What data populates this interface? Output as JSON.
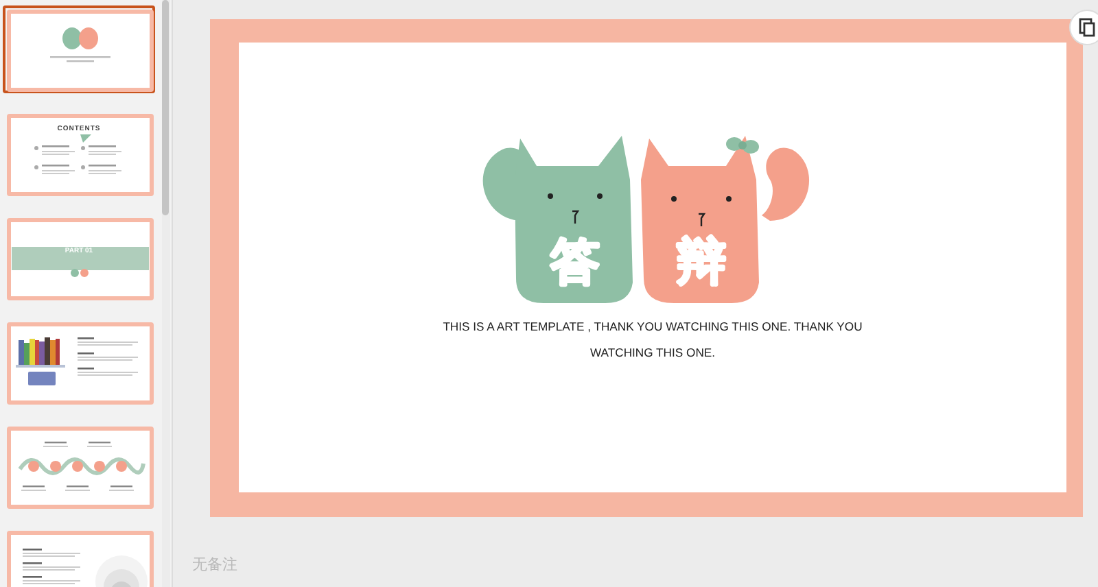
{
  "thumbnails": [
    {
      "kind": "title",
      "selected": true
    },
    {
      "kind": "contents",
      "heading": "CONTENTS",
      "selected": false
    },
    {
      "kind": "section",
      "heading": "PART 01",
      "selected": false
    },
    {
      "kind": "books",
      "selected": false
    },
    {
      "kind": "timeline",
      "selected": false
    },
    {
      "kind": "rings",
      "selected": false
    }
  ],
  "slide": {
    "title_chars": [
      {
        "char": "答"
      },
      {
        "char": "辩"
      }
    ],
    "caption": "THIS IS A ART TEMPLATE , THANK YOU WATCHING THIS ONE. THANK YOU WATCHING THIS ONE."
  },
  "notes": {
    "placeholder": "无备注"
  }
}
